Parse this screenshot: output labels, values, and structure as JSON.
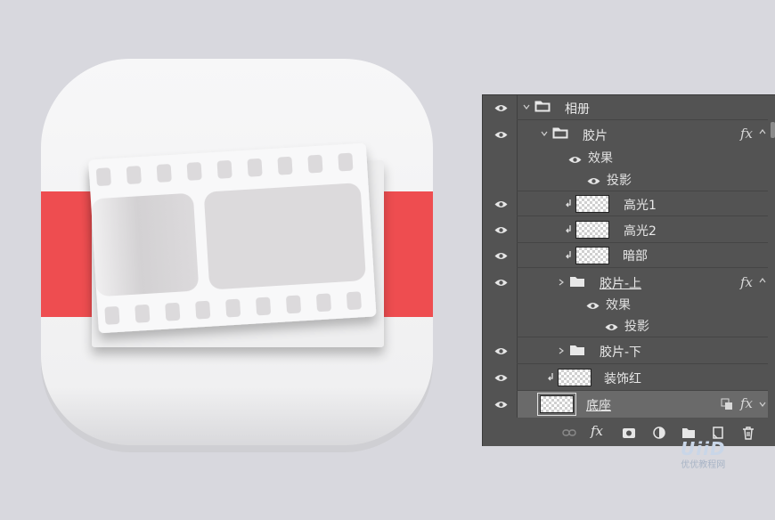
{
  "colors": {
    "background": "#d8d8de",
    "panel_bg": "#535353",
    "ribbon_red": "#ee4d50",
    "icon_white": "#f5f5f6",
    "film_gray": "#dcdadc"
  },
  "layers": [
    {
      "name": "相册",
      "type": "group",
      "expanded": true,
      "visible": true
    },
    {
      "name": "胶片",
      "type": "group",
      "expanded": true,
      "visible": true,
      "fx": "fx",
      "effects_label": "效果",
      "effects": [
        "投影"
      ]
    },
    {
      "name": "高光1",
      "type": "layer",
      "clipped": true,
      "visible": true
    },
    {
      "name": "高光2",
      "type": "layer",
      "clipped": true,
      "visible": true
    },
    {
      "name": "暗部",
      "type": "layer",
      "clipped": true,
      "visible": true
    },
    {
      "name": "胶片-上",
      "type": "group",
      "expanded": false,
      "visible": true,
      "fx": "fx",
      "effects_label": "效果",
      "effects": [
        "投影"
      ]
    },
    {
      "name": "胶片-下",
      "type": "group",
      "expanded": false,
      "visible": true
    },
    {
      "name": "装饰红",
      "type": "layer",
      "clipped": true,
      "visible": true
    },
    {
      "name": "底座",
      "type": "layer",
      "selected": true,
      "visible": true,
      "fx": "fx"
    }
  ],
  "toolbar_icons": [
    "link-icon",
    "fx-icon",
    "mask-icon",
    "adjustment-icon",
    "folder-icon",
    "new-layer-icon",
    "trash-icon"
  ],
  "toolbar_fx": "fx",
  "watermark": {
    "logo": "UiiD",
    "text": "优优教程网"
  }
}
